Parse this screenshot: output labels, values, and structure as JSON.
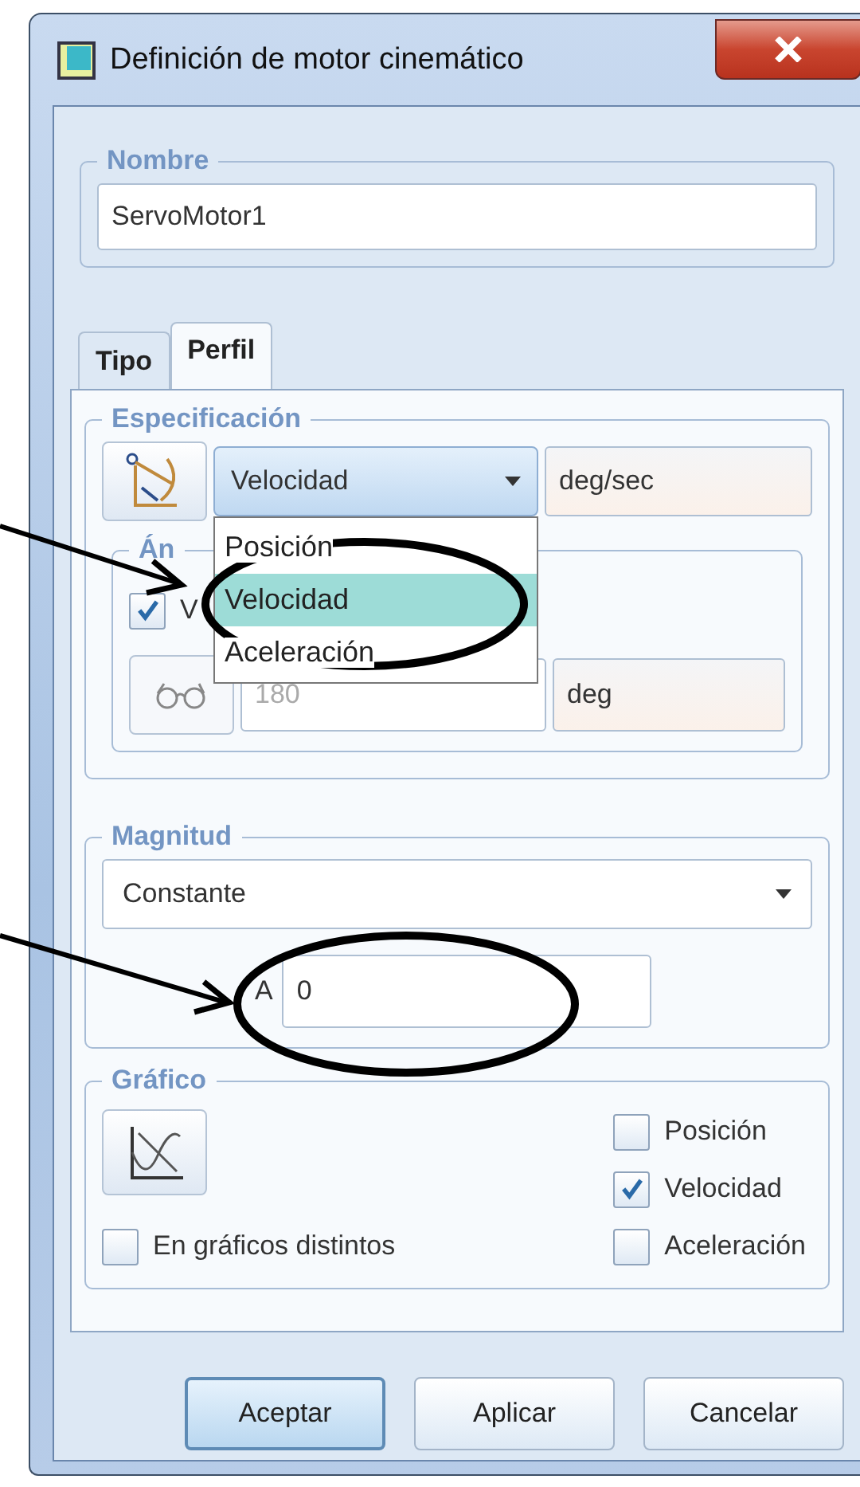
{
  "window": {
    "title": "Definición de motor cinemático"
  },
  "name_group": {
    "label": "Nombre",
    "value": "ServoMotor1"
  },
  "tabs": [
    {
      "label": "Tipo",
      "selected": false
    },
    {
      "label": "Perfil",
      "selected": true
    }
  ],
  "specification": {
    "label": "Especificación",
    "dropdown": {
      "value": "Velocidad",
      "expanded": true,
      "options": [
        {
          "label": "Posición",
          "selected": false
        },
        {
          "label": "Velocidad",
          "selected": true
        },
        {
          "label": "Aceleración",
          "selected": false
        }
      ]
    },
    "unit": "deg/sec"
  },
  "angle_group": {
    "label": "Án",
    "checkbox": {
      "label": "V",
      "checked": true
    },
    "value": "180",
    "disabled": true,
    "unit": "deg"
  },
  "magnitude": {
    "label": "Magnitud",
    "dropdown": {
      "value": "Constante"
    },
    "field": {
      "label": "A",
      "value": "0"
    }
  },
  "graph": {
    "label": "Gráfico",
    "separate": {
      "label": "En gráficos distintos",
      "checked": false
    },
    "series": [
      {
        "label": "Posición",
        "checked": false
      },
      {
        "label": "Velocidad",
        "checked": true
      },
      {
        "label": "Aceleración",
        "checked": false
      }
    ]
  },
  "buttons": [
    {
      "label": "Aceptar",
      "default": true
    },
    {
      "label": "Aplicar",
      "default": false
    },
    {
      "label": "Cancelar",
      "default": false
    }
  ]
}
